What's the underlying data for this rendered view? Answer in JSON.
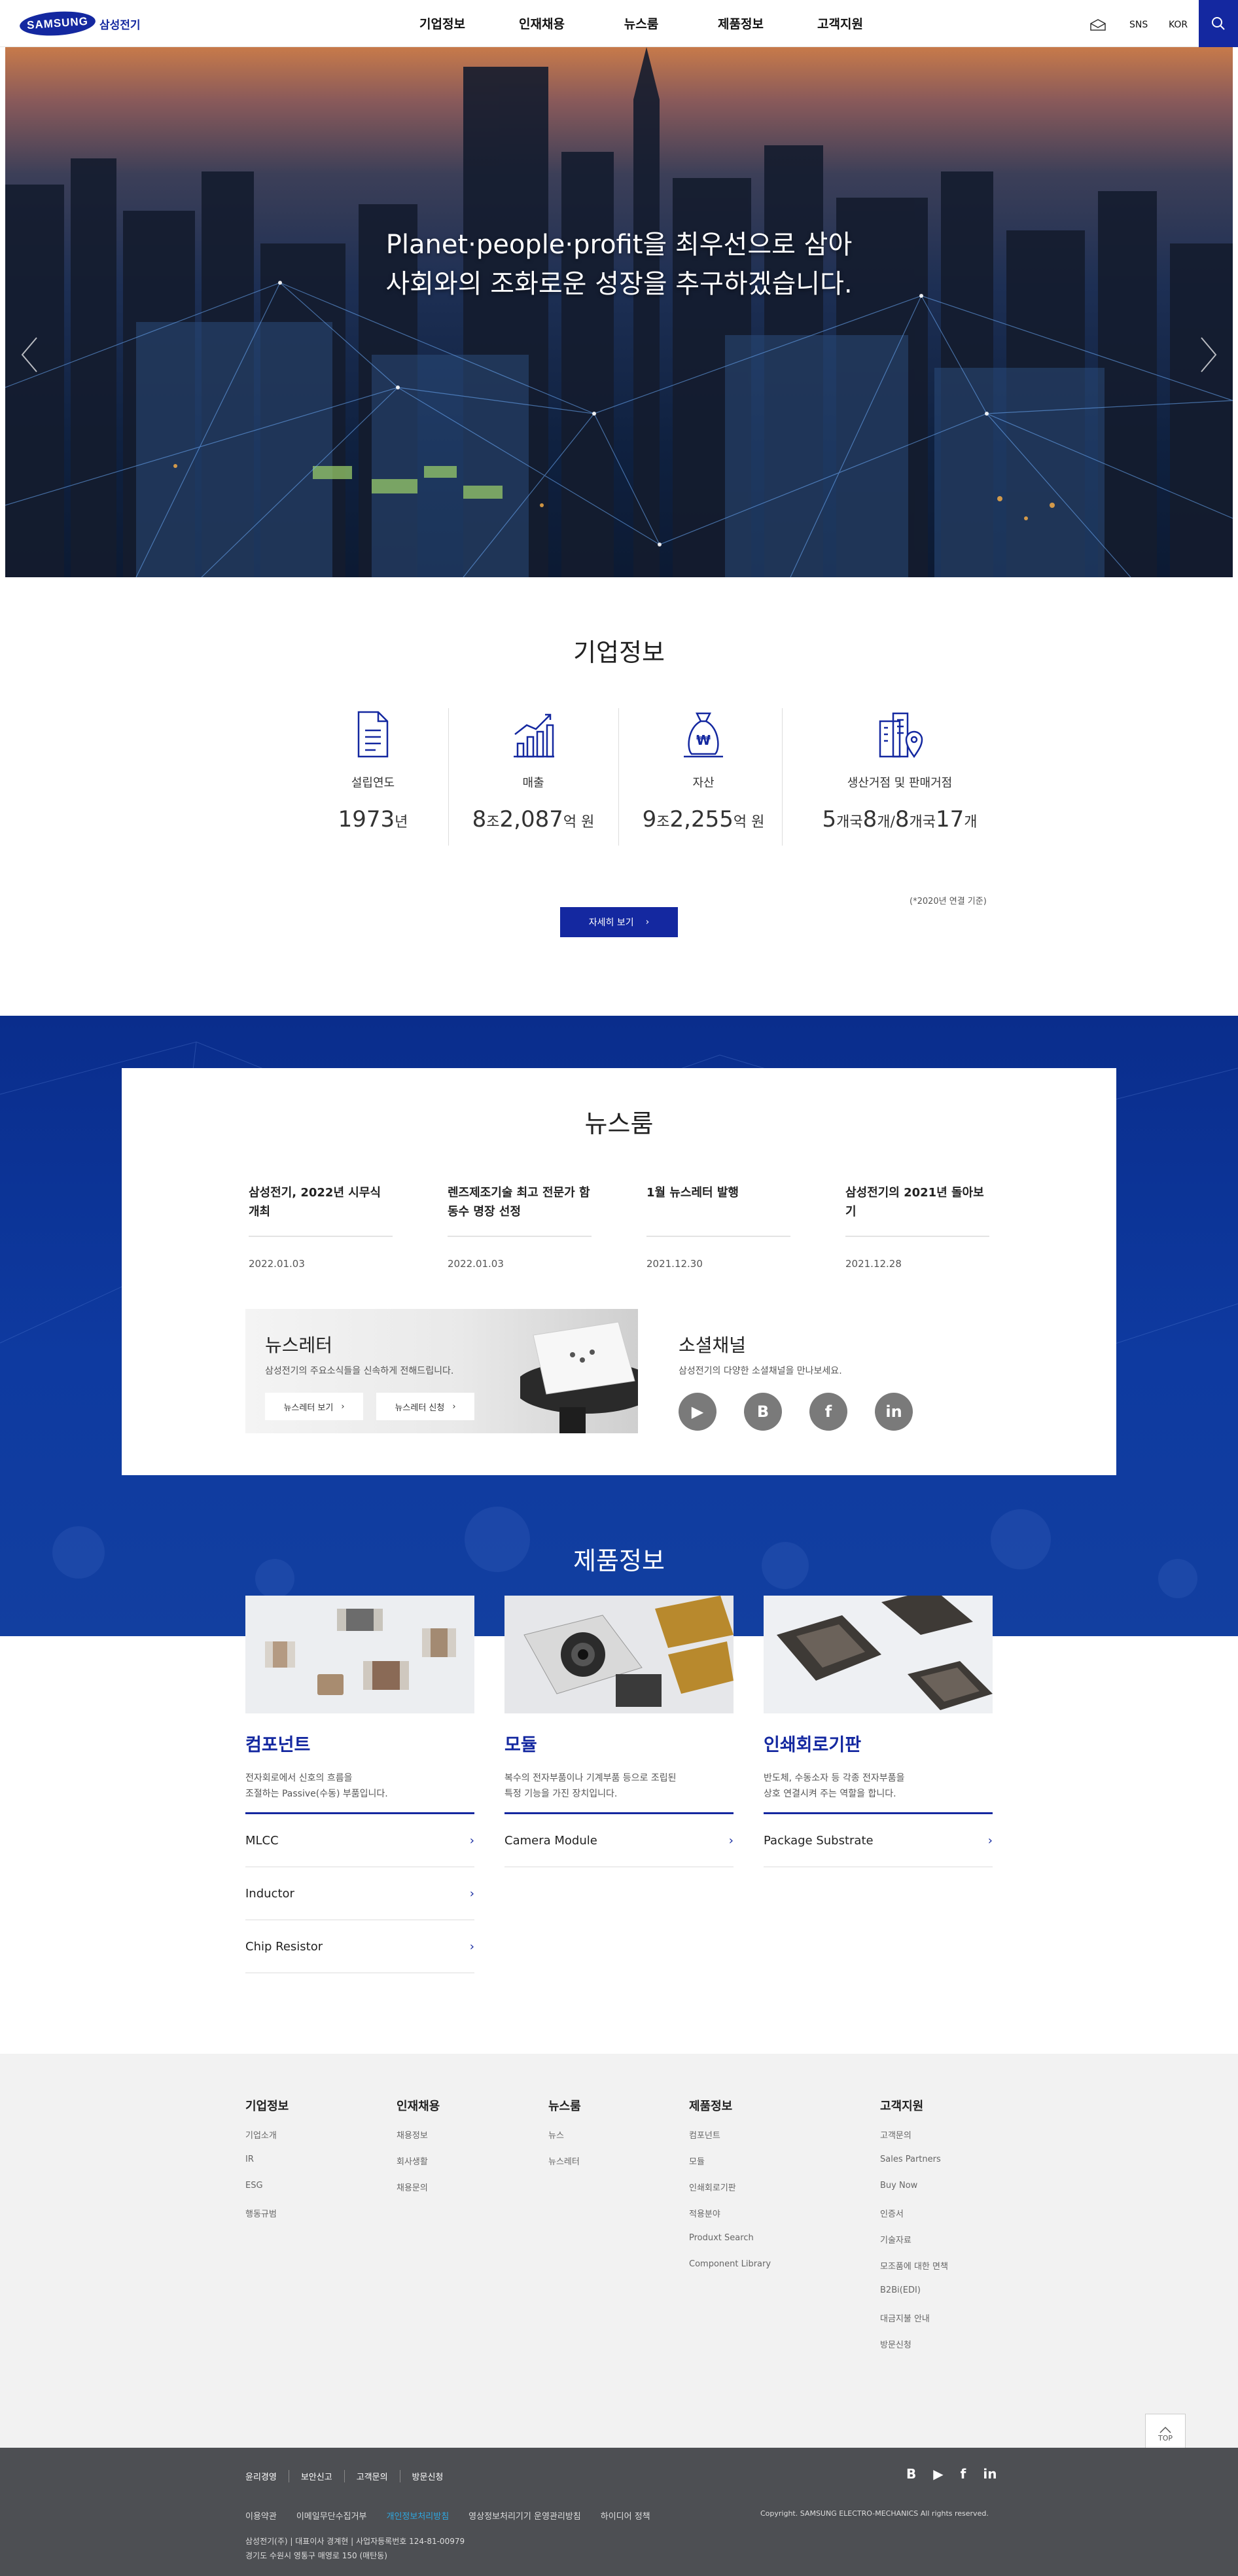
{
  "header": {
    "logo_text": "SAMSUNG",
    "logo_sub": "삼성전기",
    "nav": [
      "기업정보",
      "인재채용",
      "뉴스룸",
      "제품정보",
      "고객지원"
    ],
    "sns": "SNS",
    "lang": "KOR"
  },
  "hero": {
    "line1": "Planet·people·profit을 최우선으로 삼아",
    "line2": "사회와의 조화로운 성장을 추구하겠습니다."
  },
  "company": {
    "title": "기업정보",
    "stats": [
      {
        "label": "설립연도",
        "v1": "1973",
        "u1": "년"
      },
      {
        "label": "매출",
        "v1": "8",
        "u1": "조",
        "v2": "2,087",
        "u2": "억 원"
      },
      {
        "label": "자산",
        "v1": "9",
        "u1": "조",
        "v2": "2,255",
        "u2": "억 원"
      },
      {
        "label": "생산거점 및 판매거점",
        "v1": "5",
        "u1": "개국",
        "v2": "8",
        "u2": "개/",
        "v3": "8",
        "u3": "개국",
        "v4": "17",
        "u4": "개"
      }
    ],
    "note": "(*2020년 연결 기준)",
    "more": "자세히 보기"
  },
  "news": {
    "title": "뉴스룸",
    "items": [
      {
        "title": "삼성전기, 2022년 시무식 개최",
        "date": "2022.01.03"
      },
      {
        "title": "렌즈제조기술 최고 전문가 함동수 명장 선정",
        "date": "2022.01.03"
      },
      {
        "title": "1월 뉴스레터 발행",
        "date": "2021.12.30"
      },
      {
        "title": "삼성전기의 2021년 돌아보기",
        "date": "2021.12.28"
      }
    ],
    "newsletter": {
      "title": "뉴스레터",
      "desc": "삼성전기의 주요소식들을 신속하게 전해드립니다.",
      "btn_view": "뉴스레터 보기",
      "btn_sub": "뉴스레터 신청"
    },
    "social": {
      "title": "소셜채널",
      "desc": "삼성전기의 다양한 소셜채널을 만나보세요.",
      "icons": [
        "▶",
        "B",
        "f",
        "in"
      ]
    }
  },
  "products": {
    "title": "제품정보",
    "cards": [
      {
        "name": "컴포넌트",
        "desc1": "전자회로에서 신호의 흐름을",
        "desc2": "조절하는 Passive(수동) 부품입니다.",
        "links": [
          "MLCC",
          "Inductor",
          "Chip Resistor"
        ]
      },
      {
        "name": "모듈",
        "desc1": "복수의 전자부품이나 기계부품 등으로 조립된",
        "desc2": "특정 기능을 가진 장치입니다.",
        "links": [
          "Camera Module"
        ]
      },
      {
        "name": "인쇄회로기판",
        "desc1": "반도체, 수동소자 등 각종 전자부품을",
        "desc2": "상호 연결시켜 주는 역할을 합니다.",
        "links": [
          "Package Substrate"
        ]
      }
    ]
  },
  "footer": {
    "cols": [
      {
        "h": "기업정보",
        "items": [
          "기업소개",
          "IR",
          "ESG",
          "행동규범"
        ]
      },
      {
        "h": "인재채용",
        "items": [
          "채용정보",
          "회사생활",
          "채용문의"
        ]
      },
      {
        "h": "뉴스룸",
        "items": [
          "뉴스",
          "뉴스레터"
        ]
      },
      {
        "h": "제품정보",
        "items": [
          "컴포넌트",
          "모듈",
          "인쇄회로기판",
          "적용분야",
          "Produxt Search",
          "Component Library"
        ]
      },
      {
        "h": "고객지원",
        "items": [
          "고객문의",
          "Sales Partners",
          "Buy Now",
          "인증서",
          "기술자료",
          "모조품에 대한 면책",
          "B2Bi(EDI)",
          "대금지불 안내",
          "방문신청"
        ]
      }
    ],
    "top": "TOP",
    "bottom_links": [
      "윤리경영",
      "보안신고",
      "고객문의",
      "방문신청"
    ],
    "social": [
      "B",
      "▶",
      "f",
      "in"
    ],
    "policy_links": [
      "이용약관",
      "이메일무단수집거부",
      "개인정보처리방침",
      "영상정보처리기기 운영관리방침",
      "하이디어 정책"
    ],
    "policy_highlight_color": "#2ea7e0",
    "copyright": "Copyright. SAMSUNG ELECTRO-MECHANICS All rights reserved.",
    "addr1": "삼성전기(주) | 대표이사 경계현 | 사업자등록번호 124-81-00979",
    "addr2": "경기도 수원시 영통구 매영로 150 (매탄동)"
  },
  "colors": {
    "brand": "#1428a0",
    "footer_dark": "#4d4f53"
  }
}
